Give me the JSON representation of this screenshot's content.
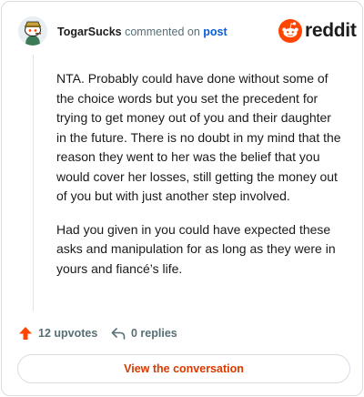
{
  "comment": {
    "username": "TogarSucks",
    "verb": "commented on",
    "post_link": "post",
    "paragraphs": [
      "NTA. Probably could have done without some of the choice words but you set the precedent for trying to get money out of you and their daughter in the future. There is no doubt in my mind that the reason they went to her was the belief that you would cover her losses, still getting the money out of you but with just another step involved.",
      "Had you given in you could have expected these asks and manipulation for as long as they were in yours and fiancé’s life."
    ]
  },
  "brand": {
    "name": "reddit",
    "accent": "#ff4500"
  },
  "actions": {
    "upvotes": "12 upvotes",
    "replies": "0 replies"
  },
  "footer": {
    "view_label": "View the conversation"
  },
  "colors": {
    "link": "#0a5cd8",
    "upvote": "#ff4500",
    "cta": "#d93a00",
    "muted": "#576f76"
  }
}
